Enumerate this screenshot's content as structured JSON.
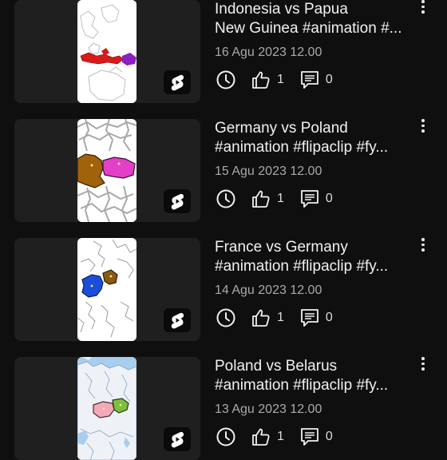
{
  "videos": [
    {
      "title": "Indonesia vs Papua\nNew Guinea #animation #...",
      "date": "16 Agu 2023 12.00",
      "likes": "1",
      "comments": "0",
      "thumbnail": "indonesia-map"
    },
    {
      "title": "Germany vs Poland\n#animation #flipaclip #fy...",
      "date": "15 Agu 2023 12.00",
      "likes": "1",
      "comments": "0",
      "thumbnail": "germany-poland-map"
    },
    {
      "title": "France vs Germany\n#animation #flipaclip #fy...",
      "date": "14 Agu 2023 12.00",
      "likes": "1",
      "comments": "0",
      "thumbnail": "france-germany-map"
    },
    {
      "title": "Poland vs Belarus\n#animation #flipaclip #fy...",
      "date": "13 Agu 2023 12.00",
      "likes": "1",
      "comments": "0",
      "thumbnail": "poland-belarus-map"
    }
  ],
  "icons": {
    "shorts": "shorts-icon",
    "schedule": "clock-icon",
    "likes": "thumbs-up-icon",
    "comments": "comment-icon",
    "menu": "more-vert-icon"
  },
  "colors": {
    "background": "#0f0f0f",
    "card": "#1f1f1f",
    "secondary_text": "#aaaaaa",
    "shorts_red": "#ff0000"
  }
}
